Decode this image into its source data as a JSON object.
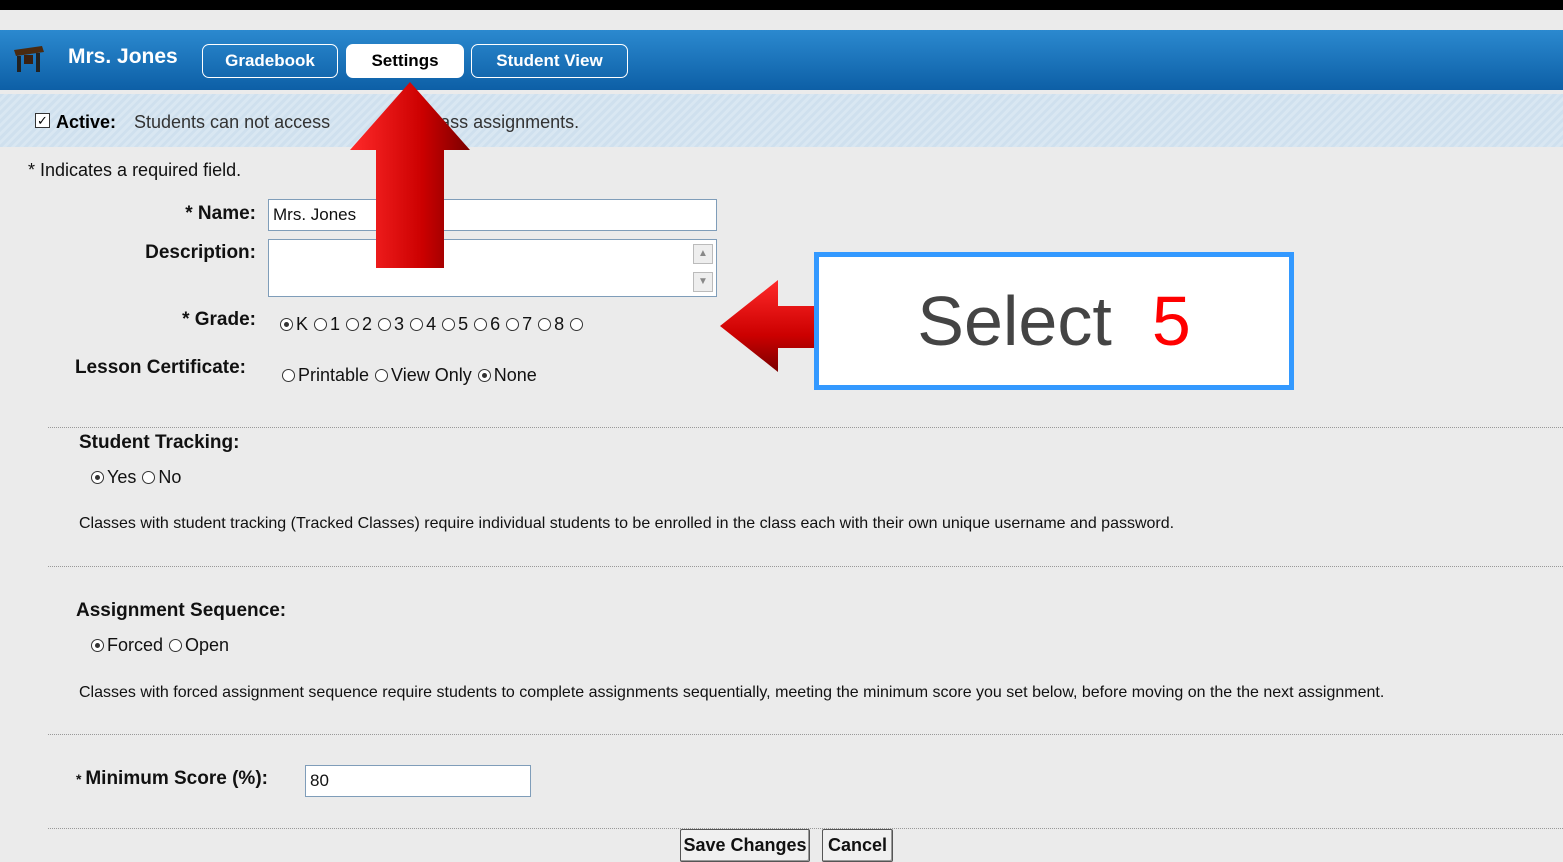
{
  "header": {
    "teacher_name": "Mrs. Jones",
    "tabs": [
      {
        "label": "Gradebook",
        "active": false
      },
      {
        "label": "Settings",
        "active": true
      },
      {
        "label": "Student View",
        "active": false
      }
    ]
  },
  "active_bar": {
    "checked": true,
    "label": "Active:",
    "text": "Students can not access",
    "text_tail": "ass assignments."
  },
  "form": {
    "required_note": "* Indicates a required field.",
    "name_label": "* Name:",
    "name_value": "Mrs. Jones",
    "description_label": "Description:",
    "description_value": "",
    "grade_label": "* Grade:",
    "grade_options": [
      "K",
      "1",
      "2",
      "3",
      "4",
      "5",
      "6",
      "7",
      "8"
    ],
    "grade_selected": "K",
    "certificate_label": "Lesson Certificate:",
    "certificate_options": [
      "Printable",
      "View Only",
      "None"
    ],
    "certificate_selected": "None",
    "tracking_label": "Student Tracking:",
    "tracking_options": [
      "Yes",
      "No"
    ],
    "tracking_selected": "Yes",
    "tracking_desc": "Classes with student tracking (Tracked Classes) require individual students to be enrolled in the class each with their own unique username and password.",
    "sequence_label": "Assignment Sequence:",
    "sequence_options": [
      "Forced",
      "Open"
    ],
    "sequence_selected": "Forced",
    "sequence_desc": "Classes with forced assignment sequence require students to complete assignments sequentially, meeting the minimum score you set below, before moving on the the next assignment.",
    "min_score_label": "Minimum Score (%):",
    "min_score_value": "80",
    "save_label": "Save Changes",
    "cancel_label": "Cancel"
  },
  "annotation": {
    "text": "Select",
    "number": "5",
    "arrow_color": "#cc0000",
    "box_border": "#3399ff"
  }
}
